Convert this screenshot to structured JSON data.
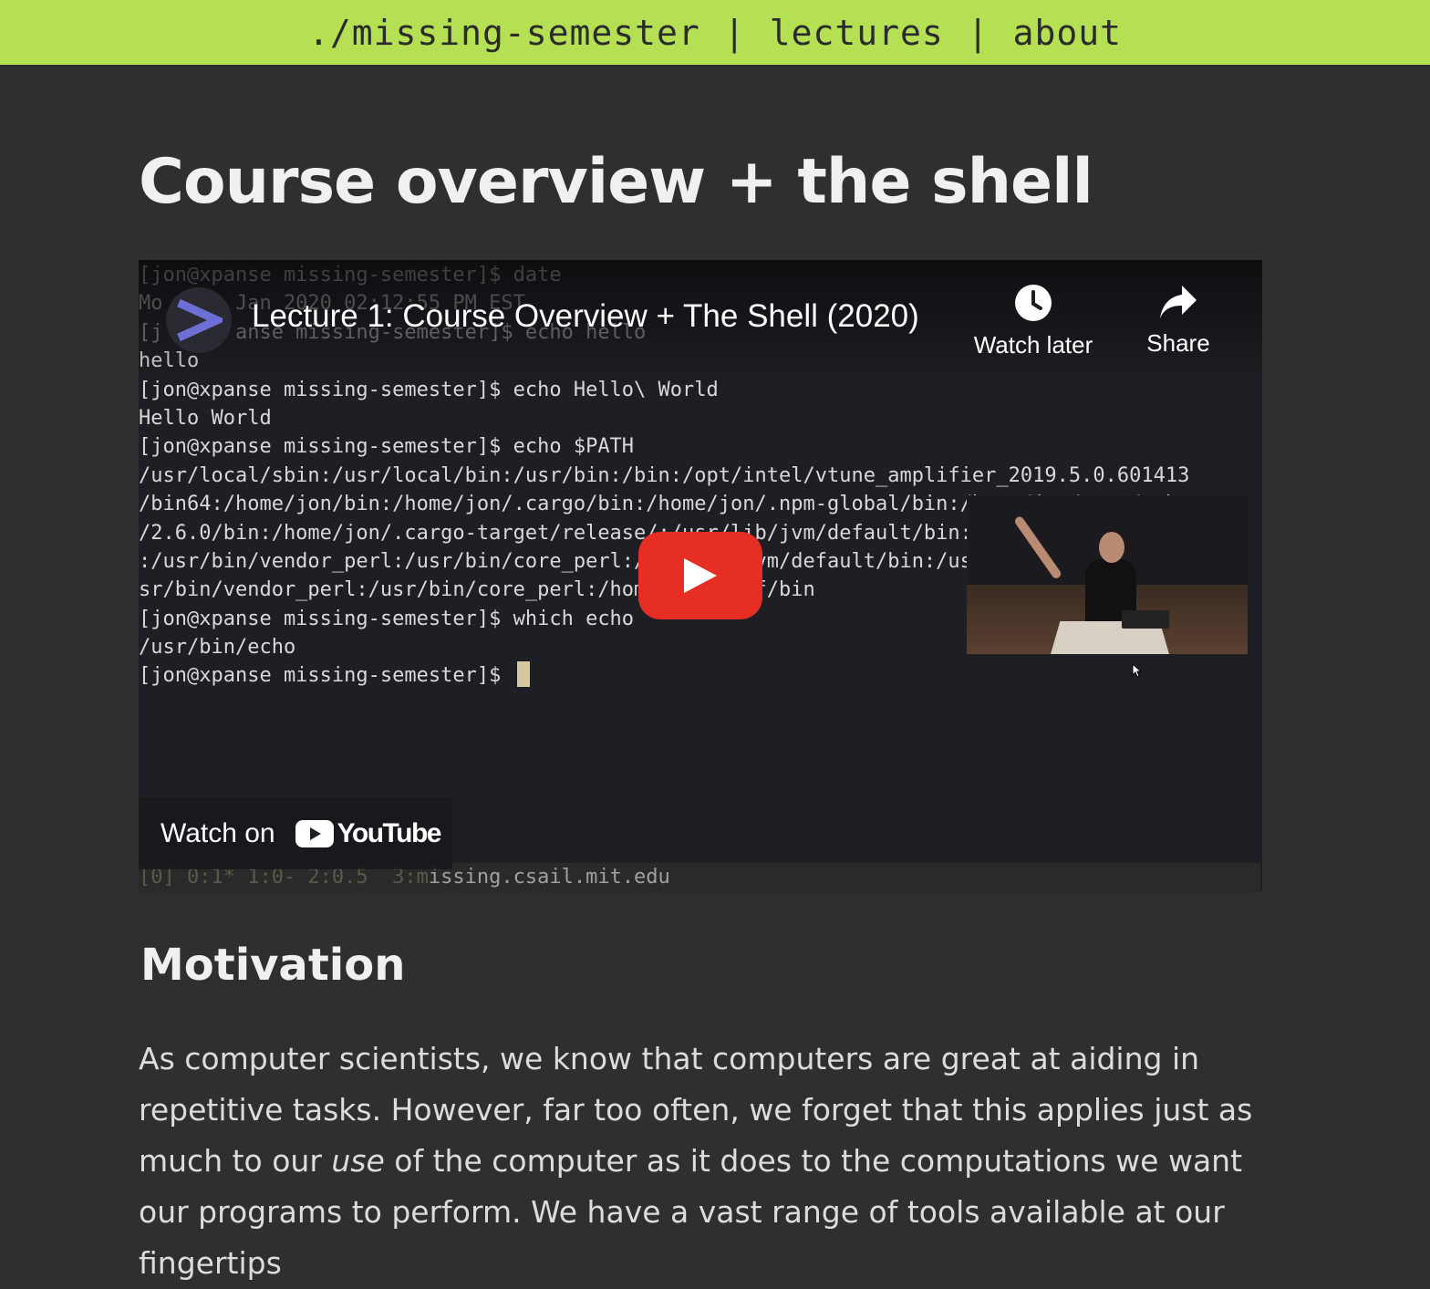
{
  "nav": {
    "site": "./missing-semester",
    "separator": "|",
    "lectures": "lectures",
    "about": "about"
  },
  "page_title": "Course overview + the shell",
  "video": {
    "title": "Lecture 1: Course Overview + The Shell (2020)",
    "watch_later": "Watch later",
    "share": "Share",
    "watch_on": "Watch on",
    "youtube": "YouTube",
    "terminal_lines": [
      "[jon@xpanse missing-semester]$ date",
      "Mo      Jan 2020 02:12:55 PM EST",
      "[j      anse missing-semester]$ echo hello",
      "hello",
      "[jon@xpanse missing-semester]$ echo Hello\\ World",
      "Hello World",
      "[jon@xpanse missing-semester]$ echo $PATH",
      "/usr/local/sbin:/usr/local/bin:/usr/bin:/bin:/opt/intel/vtune_amplifier_2019.5.0.601413",
      "/bin64:/home/jon/bin:/home/jon/.cargo/bin:/home/jon/.npm-global/bin:/home/jon/.gem/ruby",
      "/2.6.0/bin:/home/jon/.cargo-target/release/:/usr/lib/jvm/default/bin:/usr/bin/site_perl",
      ":/usr/bin/vendor_perl:/usr/bin/core_perl:/usr/lib/jvm/default/bin:/usr/bin/site_perl:/u",
      "sr/bin/vendor_perl:/usr/bin/core_perl:/home/jon/.fzf/bin",
      "[jon@xpanse missing-semester]$ which echo",
      "/usr/bin/echo",
      "[jon@xpanse missing-semester]$ "
    ],
    "status_faded": "[0] 0:1* 1:0- 2:0.5  3:m",
    "status_text": "issing.csail.mit.edu"
  },
  "motivation": {
    "heading": "Motivation",
    "p_part1": "As computer scientists, we know that computers are great at aiding in repetitive tasks. However, far too often, we forget that this applies just as much to our ",
    "p_em": "use",
    "p_part2": " of the computer as it does to the computations we want our programs to perform. We have a vast range of tools available at our fingertips"
  },
  "colors": {
    "nav_bg": "#b5e053",
    "page_bg": "#2f2f2f",
    "play_red": "#e62e25",
    "channel_logo": "#6d6fd6"
  }
}
